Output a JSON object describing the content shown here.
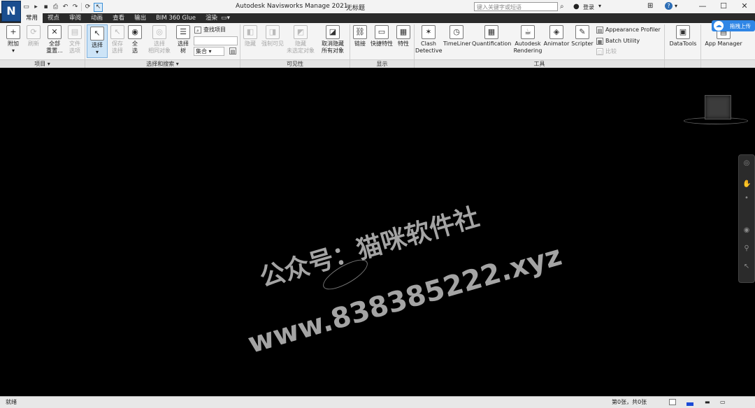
{
  "titlebar": {
    "app_logo": "N",
    "app_title": "Autodesk Navisworks Manage 2021",
    "doc_title": "无标题",
    "search_placeholder": "键入关键字或短语",
    "login_label": "登录",
    "window_controls": [
      "—",
      "☐",
      "✕"
    ]
  },
  "tabs": [
    {
      "label": "常用",
      "active": true
    },
    {
      "label": "视点",
      "active": false
    },
    {
      "label": "审阅",
      "active": false
    },
    {
      "label": "动画",
      "active": false
    },
    {
      "label": "查看",
      "active": false
    },
    {
      "label": "输出",
      "active": false
    },
    {
      "label": "BIM 360 Glue",
      "active": false
    },
    {
      "label": "渲染",
      "active": false
    }
  ],
  "upload_badge": "拖拽上传",
  "ribbon": {
    "project_panel": {
      "title": "项目",
      "buttons": [
        {
          "label": "附加",
          "enabled": true
        },
        {
          "label": "刷新",
          "enabled": false
        },
        {
          "label": "全部",
          "label2": "重置...",
          "enabled": true
        },
        {
          "label": "文件",
          "label2": "选项",
          "enabled": false
        }
      ]
    },
    "select_panel": {
      "title": "选择和搜索",
      "buttons": [
        {
          "label": "选择",
          "enabled": true
        },
        {
          "label": "保存",
          "label2": "选择",
          "enabled": false
        },
        {
          "label": "全",
          "label2": "选",
          "enabled": true
        },
        {
          "label": "选择",
          "label2": "相同对象",
          "enabled": false
        },
        {
          "label": "选择",
          "label2": "树",
          "enabled": true
        }
      ],
      "find_items": "查找项目",
      "set_combo": "集合"
    },
    "visibility_panel": {
      "title": "可见性",
      "buttons": [
        {
          "label": "隐藏",
          "enabled": false
        },
        {
          "label": "强制可见",
          "enabled": false
        },
        {
          "label": "隐藏",
          "label2": "未选定对象",
          "enabled": false
        },
        {
          "label": "取消隐藏",
          "label2": "所有对象",
          "enabled": true
        }
      ]
    },
    "display_panel": {
      "title": "显示",
      "buttons": [
        {
          "label": "链接"
        },
        {
          "label": "快捷特性"
        },
        {
          "label": "特性"
        }
      ]
    },
    "tools_panel": {
      "title": "工具",
      "buttons": [
        {
          "label": "Clash",
          "label2": "Detective"
        },
        {
          "label": "TimeLiner",
          "label2": ""
        },
        {
          "label": "Quantification",
          "label2": ""
        },
        {
          "label": "Autodesk",
          "label2": "Rendering"
        },
        {
          "label": "Animator",
          "label2": ""
        },
        {
          "label": "Scripter",
          "label2": ""
        }
      ],
      "small_items": [
        {
          "label": "Appearance Profiler",
          "enabled": true
        },
        {
          "label": "Batch Utility",
          "enabled": true
        },
        {
          "label": "比较",
          "enabled": false
        }
      ]
    },
    "datatools": "DataTools",
    "app_manager": "App Manager"
  },
  "watermark": {
    "line1": "公众号：猫咪软件社",
    "line2": "www.838385222.xyz"
  },
  "status": {
    "left": "就绪",
    "pages": "第0张，共0张"
  }
}
